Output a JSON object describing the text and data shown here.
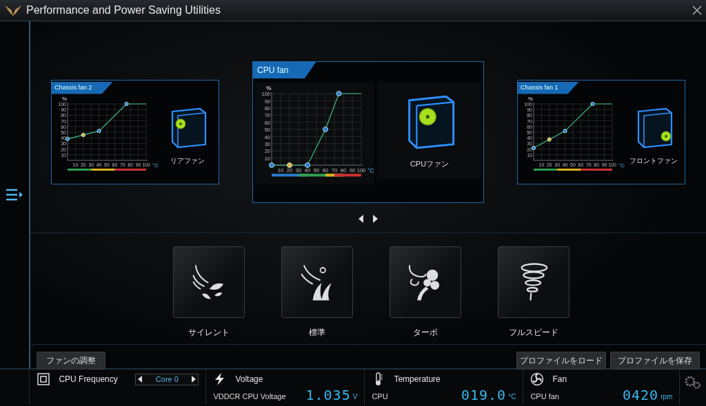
{
  "window": {
    "title": "Performance and Power Saving Utilities"
  },
  "fans": [
    {
      "title": "Chassis fan 2",
      "caption": "リアファン",
      "selected": false,
      "kind": "rear",
      "chart_data": {
        "type": "line",
        "grid": true,
        "ylabel": "%",
        "xlabel": "°C",
        "x": [
          0,
          20,
          40,
          75,
          100
        ],
        "series": [
          {
            "color": "#3fbf8f",
            "marker": "circle",
            "values": [
              38,
              45,
              52,
              100,
              100
            ]
          }
        ],
        "xlim": [
          0,
          100
        ],
        "ylim": [
          0,
          100
        ],
        "xticks": [
          10,
          20,
          30,
          40,
          50,
          60,
          70,
          80,
          90,
          100
        ],
        "yticks": [
          10,
          20,
          30,
          40,
          50,
          60,
          70,
          80,
          90,
          100
        ]
      }
    },
    {
      "title": "CPU fan",
      "caption": "CPUファン",
      "selected": true,
      "kind": "cpu",
      "chart_data": {
        "type": "line",
        "grid": true,
        "ylabel": "%",
        "xlabel": "°C",
        "x": [
          0,
          20,
          40,
          60,
          75,
          100
        ],
        "series": [
          {
            "color": "#3fbf8f",
            "marker": "circle",
            "values": [
              0,
              0,
              0,
              50,
              100,
              100
            ]
          }
        ],
        "xlim": [
          0,
          100
        ],
        "ylim": [
          0,
          100
        ],
        "xticks": [
          10,
          20,
          30,
          40,
          50,
          60,
          70,
          80,
          90,
          100
        ],
        "yticks": [
          10,
          20,
          30,
          40,
          50,
          60,
          70,
          80,
          90,
          100
        ]
      }
    },
    {
      "title": "Chassis fan 1",
      "caption": "フロントファン",
      "selected": false,
      "kind": "front",
      "chart_data": {
        "type": "line",
        "grid": true,
        "ylabel": "%",
        "xlabel": "°C",
        "x": [
          0,
          20,
          40,
          75,
          100
        ],
        "series": [
          {
            "color": "#3fbf8f",
            "marker": "circle",
            "values": [
              22,
              37,
              52,
              100,
              100
            ]
          }
        ],
        "xlim": [
          0,
          100
        ],
        "ylim": [
          0,
          100
        ],
        "xticks": [
          10,
          20,
          30,
          40,
          50,
          60,
          70,
          80,
          90,
          100
        ],
        "yticks": [
          10,
          20,
          30,
          40,
          50,
          60,
          70,
          80,
          90,
          100
        ]
      }
    }
  ],
  "modes": [
    {
      "kind": "silent",
      "label": "サイレント"
    },
    {
      "kind": "standard",
      "label": "標準"
    },
    {
      "kind": "turbo",
      "label": "ターボ"
    },
    {
      "kind": "full",
      "label": "フルスピード"
    }
  ],
  "buttons": {
    "left": "ファンの調整",
    "right": [
      "プロファイルをロード",
      "プロファイルを保存"
    ]
  },
  "status_bar": [
    {
      "kind": "frequency",
      "title": "CPU Frequency",
      "selector": "Core 0"
    },
    {
      "kind": "voltage",
      "title": "Voltage",
      "label": "VDDCR CPU Voltage",
      "value": "1.035",
      "unit": "V"
    },
    {
      "kind": "temperature",
      "title": "Temperature",
      "label": "CPU",
      "value": "019.0",
      "unit": "°C"
    },
    {
      "kind": "fan",
      "title": "Fan",
      "label": "CPU fan",
      "value": "0420",
      "unit": "rpm"
    }
  ]
}
